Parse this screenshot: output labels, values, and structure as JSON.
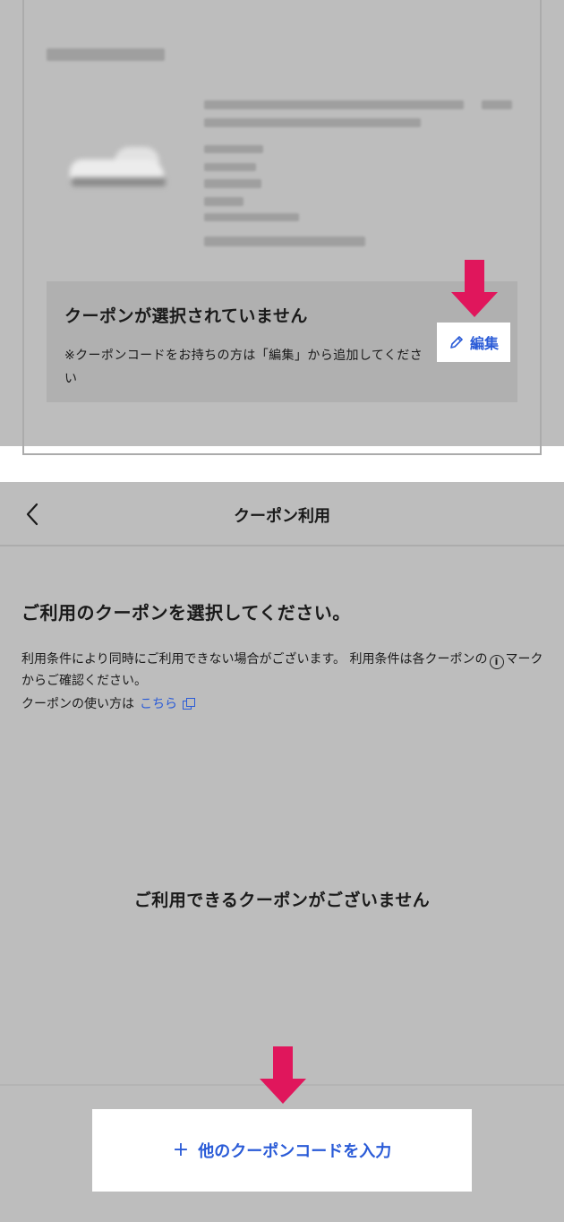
{
  "order_summary": {
    "coupon": {
      "status_title": "クーポンが選択されていません",
      "note": "※クーポンコードをお持ちの方は「編集」から追加してください",
      "edit_label": "編集"
    }
  },
  "coupon_screen": {
    "header": {
      "title": "クーポン利用",
      "back_icon": "chevron-left-icon"
    },
    "heading": "ご利用のクーポンを選択してください。",
    "terms_part1": "利用条件により同時にご利用できない場合がございます。 利用条件は各クーポンの",
    "info_glyph": "i",
    "terms_part2": "マークからご確認ください。",
    "howto_prefix": "クーポンの使い方は",
    "howto_link": "こちら",
    "empty_message": "ご利用できるクーポンがございません",
    "add_code_button": {
      "icon": "+",
      "label": "他のクーポンコードを入力"
    }
  },
  "colors": {
    "accent_blue": "#2a5bd7",
    "arrow_pink": "#e0165c",
    "panel_gray": "#bdbdbd"
  }
}
